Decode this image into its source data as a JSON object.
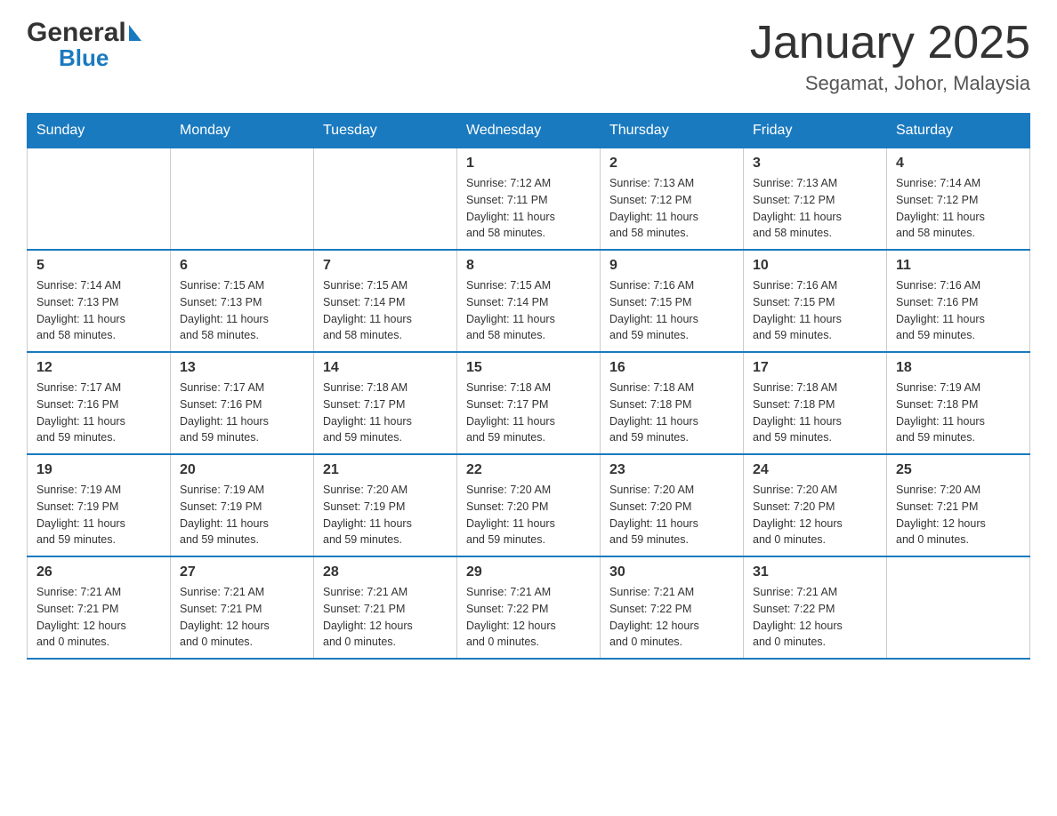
{
  "header": {
    "logo_general": "General",
    "logo_blue": "Blue",
    "month_title": "January 2025",
    "location": "Segamat, Johor, Malaysia"
  },
  "days_of_week": [
    "Sunday",
    "Monday",
    "Tuesday",
    "Wednesday",
    "Thursday",
    "Friday",
    "Saturday"
  ],
  "weeks": [
    [
      {
        "day": "",
        "info": ""
      },
      {
        "day": "",
        "info": ""
      },
      {
        "day": "",
        "info": ""
      },
      {
        "day": "1",
        "info": "Sunrise: 7:12 AM\nSunset: 7:11 PM\nDaylight: 11 hours\nand 58 minutes."
      },
      {
        "day": "2",
        "info": "Sunrise: 7:13 AM\nSunset: 7:12 PM\nDaylight: 11 hours\nand 58 minutes."
      },
      {
        "day": "3",
        "info": "Sunrise: 7:13 AM\nSunset: 7:12 PM\nDaylight: 11 hours\nand 58 minutes."
      },
      {
        "day": "4",
        "info": "Sunrise: 7:14 AM\nSunset: 7:12 PM\nDaylight: 11 hours\nand 58 minutes."
      }
    ],
    [
      {
        "day": "5",
        "info": "Sunrise: 7:14 AM\nSunset: 7:13 PM\nDaylight: 11 hours\nand 58 minutes."
      },
      {
        "day": "6",
        "info": "Sunrise: 7:15 AM\nSunset: 7:13 PM\nDaylight: 11 hours\nand 58 minutes."
      },
      {
        "day": "7",
        "info": "Sunrise: 7:15 AM\nSunset: 7:14 PM\nDaylight: 11 hours\nand 58 minutes."
      },
      {
        "day": "8",
        "info": "Sunrise: 7:15 AM\nSunset: 7:14 PM\nDaylight: 11 hours\nand 58 minutes."
      },
      {
        "day": "9",
        "info": "Sunrise: 7:16 AM\nSunset: 7:15 PM\nDaylight: 11 hours\nand 59 minutes."
      },
      {
        "day": "10",
        "info": "Sunrise: 7:16 AM\nSunset: 7:15 PM\nDaylight: 11 hours\nand 59 minutes."
      },
      {
        "day": "11",
        "info": "Sunrise: 7:16 AM\nSunset: 7:16 PM\nDaylight: 11 hours\nand 59 minutes."
      }
    ],
    [
      {
        "day": "12",
        "info": "Sunrise: 7:17 AM\nSunset: 7:16 PM\nDaylight: 11 hours\nand 59 minutes."
      },
      {
        "day": "13",
        "info": "Sunrise: 7:17 AM\nSunset: 7:16 PM\nDaylight: 11 hours\nand 59 minutes."
      },
      {
        "day": "14",
        "info": "Sunrise: 7:18 AM\nSunset: 7:17 PM\nDaylight: 11 hours\nand 59 minutes."
      },
      {
        "day": "15",
        "info": "Sunrise: 7:18 AM\nSunset: 7:17 PM\nDaylight: 11 hours\nand 59 minutes."
      },
      {
        "day": "16",
        "info": "Sunrise: 7:18 AM\nSunset: 7:18 PM\nDaylight: 11 hours\nand 59 minutes."
      },
      {
        "day": "17",
        "info": "Sunrise: 7:18 AM\nSunset: 7:18 PM\nDaylight: 11 hours\nand 59 minutes."
      },
      {
        "day": "18",
        "info": "Sunrise: 7:19 AM\nSunset: 7:18 PM\nDaylight: 11 hours\nand 59 minutes."
      }
    ],
    [
      {
        "day": "19",
        "info": "Sunrise: 7:19 AM\nSunset: 7:19 PM\nDaylight: 11 hours\nand 59 minutes."
      },
      {
        "day": "20",
        "info": "Sunrise: 7:19 AM\nSunset: 7:19 PM\nDaylight: 11 hours\nand 59 minutes."
      },
      {
        "day": "21",
        "info": "Sunrise: 7:20 AM\nSunset: 7:19 PM\nDaylight: 11 hours\nand 59 minutes."
      },
      {
        "day": "22",
        "info": "Sunrise: 7:20 AM\nSunset: 7:20 PM\nDaylight: 11 hours\nand 59 minutes."
      },
      {
        "day": "23",
        "info": "Sunrise: 7:20 AM\nSunset: 7:20 PM\nDaylight: 11 hours\nand 59 minutes."
      },
      {
        "day": "24",
        "info": "Sunrise: 7:20 AM\nSunset: 7:20 PM\nDaylight: 12 hours\nand 0 minutes."
      },
      {
        "day": "25",
        "info": "Sunrise: 7:20 AM\nSunset: 7:21 PM\nDaylight: 12 hours\nand 0 minutes."
      }
    ],
    [
      {
        "day": "26",
        "info": "Sunrise: 7:21 AM\nSunset: 7:21 PM\nDaylight: 12 hours\nand 0 minutes."
      },
      {
        "day": "27",
        "info": "Sunrise: 7:21 AM\nSunset: 7:21 PM\nDaylight: 12 hours\nand 0 minutes."
      },
      {
        "day": "28",
        "info": "Sunrise: 7:21 AM\nSunset: 7:21 PM\nDaylight: 12 hours\nand 0 minutes."
      },
      {
        "day": "29",
        "info": "Sunrise: 7:21 AM\nSunset: 7:22 PM\nDaylight: 12 hours\nand 0 minutes."
      },
      {
        "day": "30",
        "info": "Sunrise: 7:21 AM\nSunset: 7:22 PM\nDaylight: 12 hours\nand 0 minutes."
      },
      {
        "day": "31",
        "info": "Sunrise: 7:21 AM\nSunset: 7:22 PM\nDaylight: 12 hours\nand 0 minutes."
      },
      {
        "day": "",
        "info": ""
      }
    ]
  ]
}
